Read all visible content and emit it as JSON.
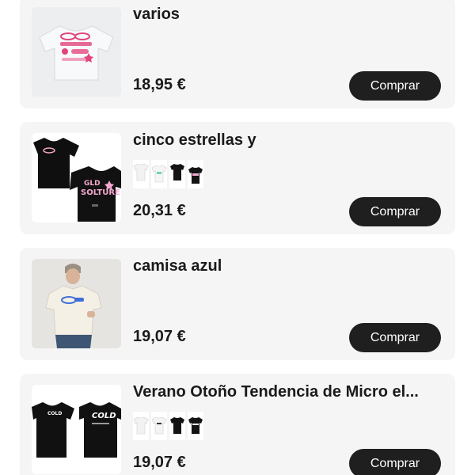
{
  "products": [
    {
      "title": "varios",
      "price": "18,95 €",
      "buy_label": "Comprar"
    },
    {
      "title": "cinco estrellas y",
      "price": "20,31 €",
      "buy_label": "Comprar"
    },
    {
      "title": "camisa azul",
      "price": "19,07 €",
      "buy_label": "Comprar"
    },
    {
      "title": "Verano Otoño Tendencia de Micro el...",
      "price": "19,07 €",
      "buy_label": "Comprar"
    }
  ],
  "colors": {
    "card_background": "#f5f5f5",
    "button_background": "#1f1f1f",
    "button_text": "#ffffff",
    "text": "#1a1a1a"
  }
}
